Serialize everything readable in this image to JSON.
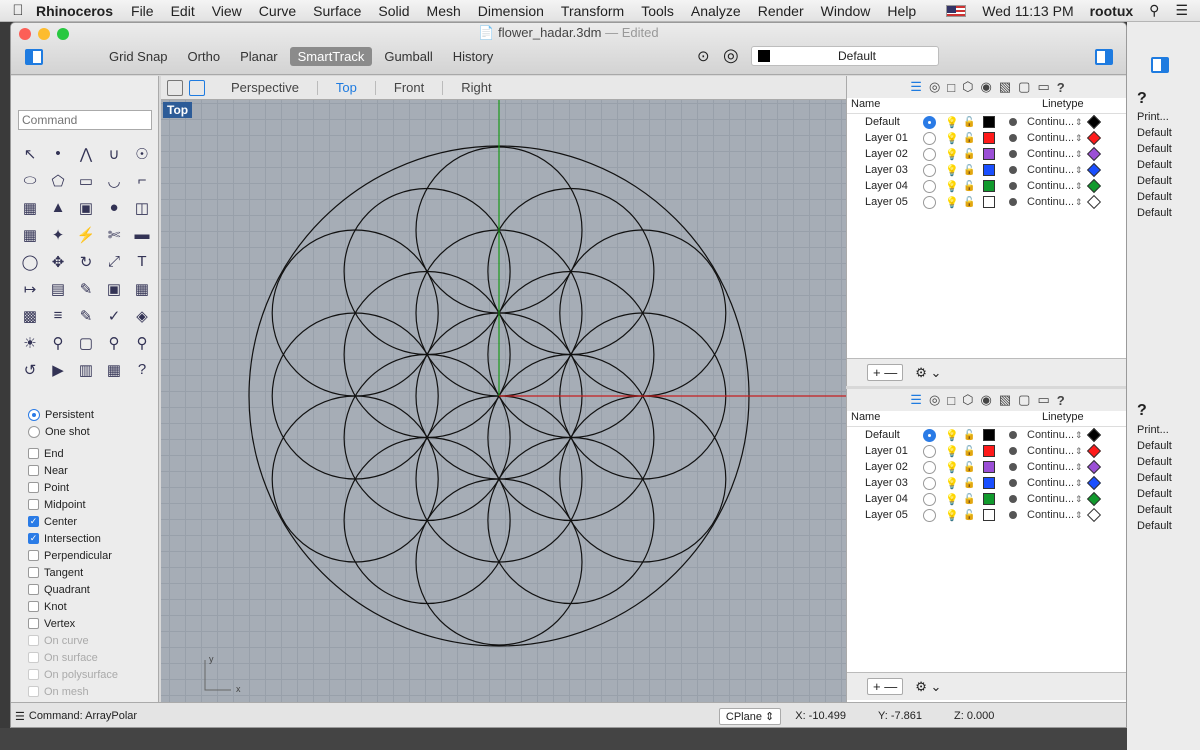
{
  "menubar": {
    "app": "Rhinoceros",
    "items": [
      "File",
      "Edit",
      "View",
      "Curve",
      "Surface",
      "Solid",
      "Mesh",
      "Dimension",
      "Transform",
      "Tools",
      "Analyze",
      "Render",
      "Window",
      "Help"
    ],
    "clock": "Wed 11:13 PM",
    "user": "rootux"
  },
  "window": {
    "filename": "flower_hadar.3dm",
    "edited": "— Edited",
    "layer_current": "Default",
    "modes": [
      "Grid Snap",
      "Ortho",
      "Planar",
      "SmartTrack",
      "Gumball",
      "History"
    ],
    "active_mode": "SmartTrack"
  },
  "command": {
    "placeholder": "Command",
    "last": "Command: ArrayPolar"
  },
  "viewport": {
    "tabs": [
      "Perspective",
      "Top",
      "Front",
      "Right"
    ],
    "active": "Top",
    "label": "Top",
    "axis_x": "x",
    "axis_y": "y"
  },
  "osnap": {
    "persistent": "Persistent",
    "oneshot": "One shot",
    "items": [
      {
        "label": "End",
        "checked": false
      },
      {
        "label": "Near",
        "checked": false
      },
      {
        "label": "Point",
        "checked": false
      },
      {
        "label": "Midpoint",
        "checked": false
      },
      {
        "label": "Center",
        "checked": true
      },
      {
        "label": "Intersection",
        "checked": true
      },
      {
        "label": "Perpendicular",
        "checked": false
      },
      {
        "label": "Tangent",
        "checked": false
      },
      {
        "label": "Quadrant",
        "checked": false
      },
      {
        "label": "Knot",
        "checked": false
      },
      {
        "label": "Vertex",
        "checked": false
      }
    ],
    "dim": [
      "On curve",
      "On surface",
      "On polysurface",
      "On mesh"
    ]
  },
  "layers": {
    "col_name": "Name",
    "col_linetype": "Linetype",
    "col_print": "Print...",
    "rows": [
      {
        "name": "Default",
        "color": "#000000",
        "linetype": "Continu...",
        "print": "Default",
        "current": true
      },
      {
        "name": "Layer 01",
        "color": "#ff1a1a",
        "linetype": "Continu...",
        "print": "Default",
        "current": false
      },
      {
        "name": "Layer 02",
        "color": "#9b4fd6",
        "linetype": "Continu...",
        "print": "Default",
        "current": false
      },
      {
        "name": "Layer 03",
        "color": "#1a4fff",
        "linetype": "Continu...",
        "print": "Default",
        "current": false
      },
      {
        "name": "Layer 04",
        "color": "#119a2d",
        "linetype": "Continu...",
        "print": "Default",
        "current": false
      },
      {
        "name": "Layer 05",
        "color": "#ffffff",
        "linetype": "Continu...",
        "print": "Default",
        "current": false
      }
    ]
  },
  "status": {
    "cplane": "CPlane",
    "x": "X: -10.499",
    "y": "Y: -7.861",
    "z": "Z: 0.000"
  },
  "colors": {
    "accent": "#1e7be0",
    "viewport_bg": "#a6adb6"
  }
}
